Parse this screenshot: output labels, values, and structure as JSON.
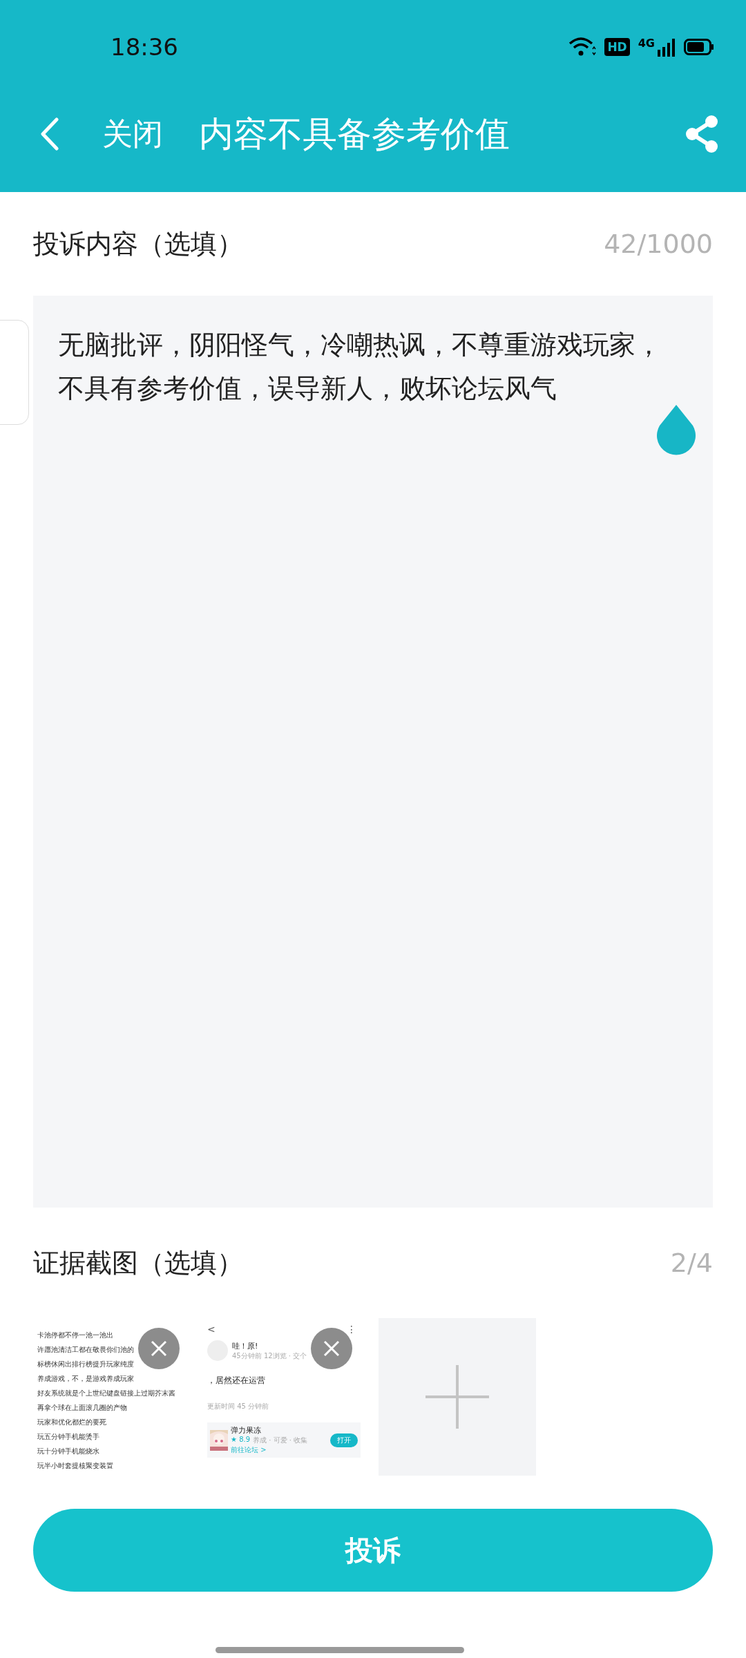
{
  "status_bar": {
    "time": "18:36",
    "hd": "HD",
    "network": "4G"
  },
  "header": {
    "close": "关闭",
    "title": "内容不具备参考价值"
  },
  "complaint": {
    "label": "投诉内容（选填）",
    "counter": "42/1000",
    "value": "无脑批评，阴阳怪气，冷嘲热讽，不尊重游戏玩家，不具有参考价值，误导新人，败坏论坛风气"
  },
  "evidence": {
    "label": "证据截图（选填）",
    "counter": "2/4",
    "images": [
      {
        "kind": "list",
        "lines": [
          "卡池停都不停一池一池出",
          "许愿池清洁工都在敬畏你们池的",
          "标榜休闲出排行榜提升玩家纯度",
          "养成游戏，不，是游戏养成玩家",
          "好友系统就是个上世纪键盘链接上过期芥末酱",
          "再拿个球在上面滚几圈的产物",
          "玩家和优化都烂的要死",
          "玩五分钟手机能烫手",
          "玩十分钟手机能烧水",
          "玩半小时套提核聚变装置"
        ]
      },
      {
        "kind": "post",
        "back": "<",
        "more": "⋮",
        "user": "哇！原!",
        "meta": "45分钟前 12浏览 · 交个",
        "body": "，居然还在运营",
        "updated": "更新时间 45 分钟前",
        "app": {
          "name": "弹力果冻",
          "rating": "★ 8.9",
          "tags": "养成 · 可爱 · 收集",
          "link": "前往论坛 >",
          "open": "打开"
        }
      },
      {
        "kind": "add"
      }
    ]
  },
  "submit": "投诉"
}
